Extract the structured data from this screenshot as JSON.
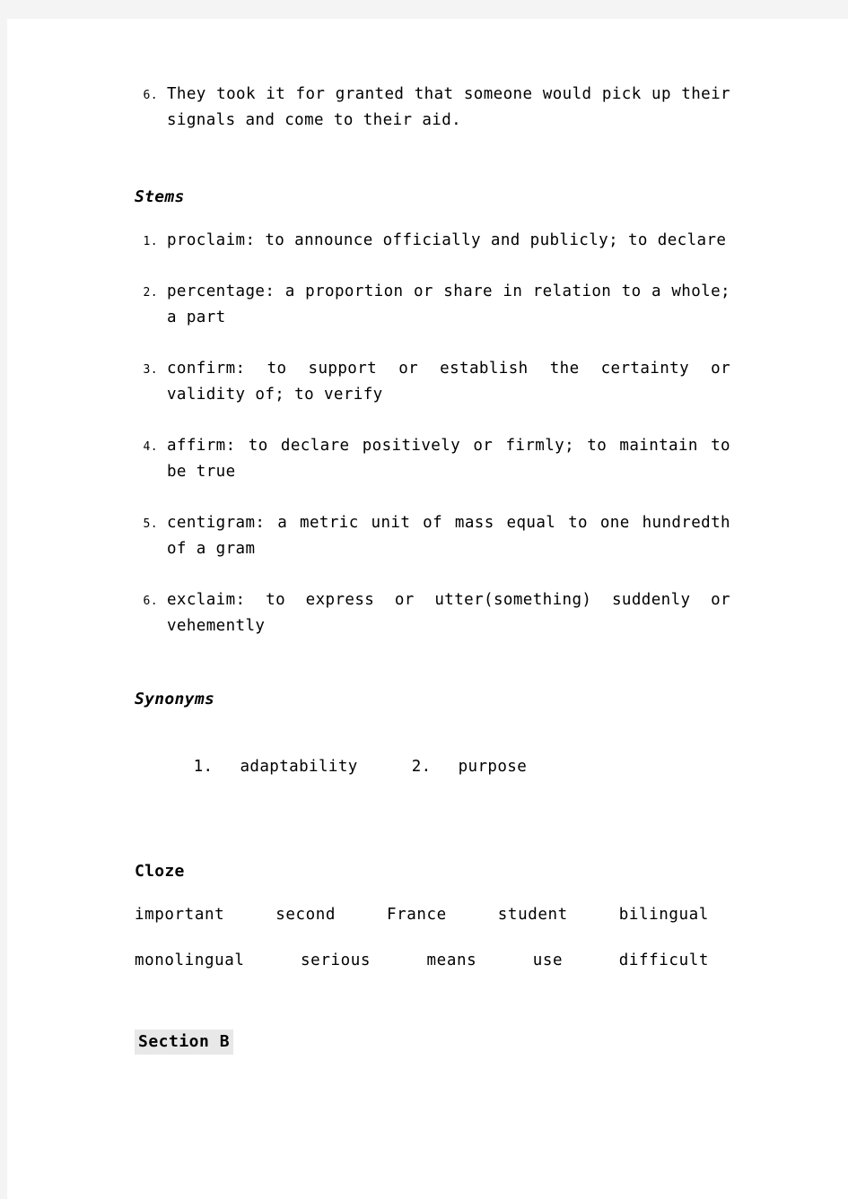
{
  "page": {
    "background_color": "#ffffff",
    "margin_color": "#f4f4f4",
    "highlight_color": "#e8e8e8"
  },
  "top_item": {
    "number": "6.",
    "text": "They took it for granted that someone would pick up their signals and come to their aid."
  },
  "sections": {
    "stems": {
      "heading": "Stems",
      "items": [
        {
          "number": "1.",
          "text": "proclaim: to announce officially and publicly; to declare"
        },
        {
          "number": "2.",
          "text": "percentage: a proportion or share in relation to a whole; a part"
        },
        {
          "number": "3.",
          "text": "confirm:    to support or establish the certainty or validity of; to verify"
        },
        {
          "number": "4.",
          "text": "affirm:    to declare positively or firmly; to maintain to be true"
        },
        {
          "number": "5.",
          "text": "centigram: a metric unit of mass equal to one hundredth of a gram"
        },
        {
          "number": "6.",
          "text": "exclaim:  to  express  or  utter(something)  suddenly  or vehemently"
        }
      ]
    },
    "synonyms": {
      "heading": "Synonyms",
      "items": [
        {
          "number": "1.",
          "text": "adaptability"
        },
        {
          "number": "2.",
          "text": "purpose"
        }
      ]
    },
    "cloze": {
      "heading": "Cloze",
      "rows": [
        [
          "important",
          "second",
          "France",
          "student",
          "bilingual"
        ],
        [
          "monolingual",
          "serious",
          "means",
          "use",
          "difficult"
        ]
      ]
    },
    "section_b": {
      "label": "Section B"
    }
  }
}
